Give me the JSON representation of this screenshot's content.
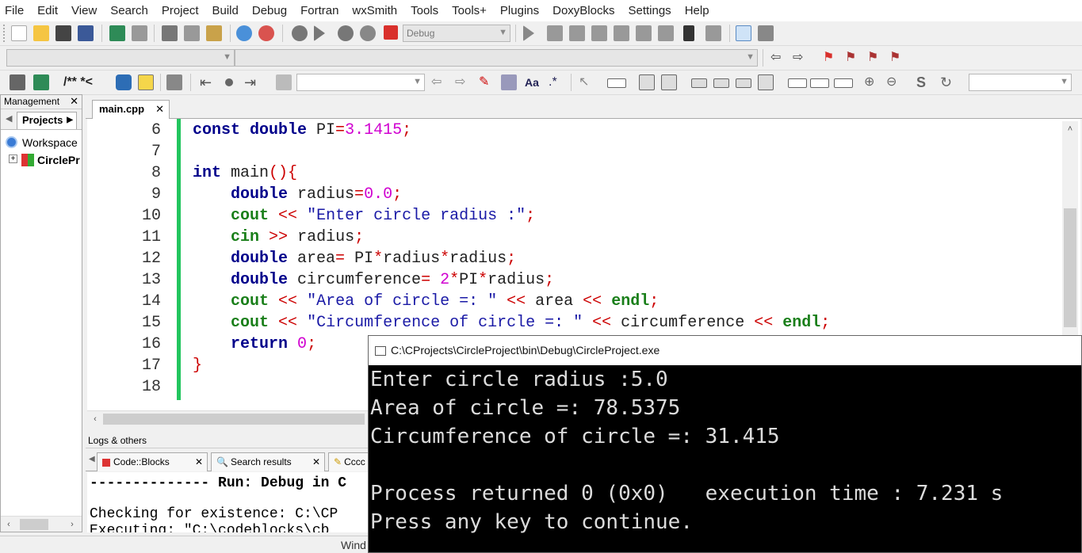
{
  "menu": [
    "File",
    "Edit",
    "View",
    "Search",
    "Project",
    "Build",
    "Debug",
    "Fortran",
    "wxSmith",
    "Tools",
    "Tools+",
    "Plugins",
    "DoxyBlocks",
    "Settings",
    "Help"
  ],
  "toolbar": {
    "build_target": "Debug",
    "doxy_label": "/** *<"
  },
  "management": {
    "title": "Management",
    "close": "✕",
    "tab": "Projects",
    "workspace": "Workspace",
    "project": "CirclePr"
  },
  "editor": {
    "tab_label": "main.cpp",
    "tab_close": "✕",
    "line_numbers": [
      "6",
      "7",
      "8",
      "9",
      "10",
      "11",
      "12",
      "13",
      "14",
      "15",
      "16",
      "17",
      "18"
    ]
  },
  "logs": {
    "title": "Logs & others",
    "tabs": [
      "Code::Blocks",
      "Search results",
      "Cccc"
    ],
    "lines": [
      "-------------- Run: Debug in C",
      "Checking for existence: C:\\CP",
      "Executing: \"C:\\codeblocks\\cb"
    ]
  },
  "status": {
    "text": "Wind"
  },
  "console": {
    "title": "C:\\CProjects\\CircleProject\\bin\\Debug\\CircleProject.exe",
    "lines": [
      "Enter circle radius :5.0",
      "Area of circle =: 78.5375",
      "Circumference of circle =: 31.415",
      "",
      "Process returned 0 (0x0)   execution time : 7.231 s",
      "Press any key to continue."
    ]
  }
}
